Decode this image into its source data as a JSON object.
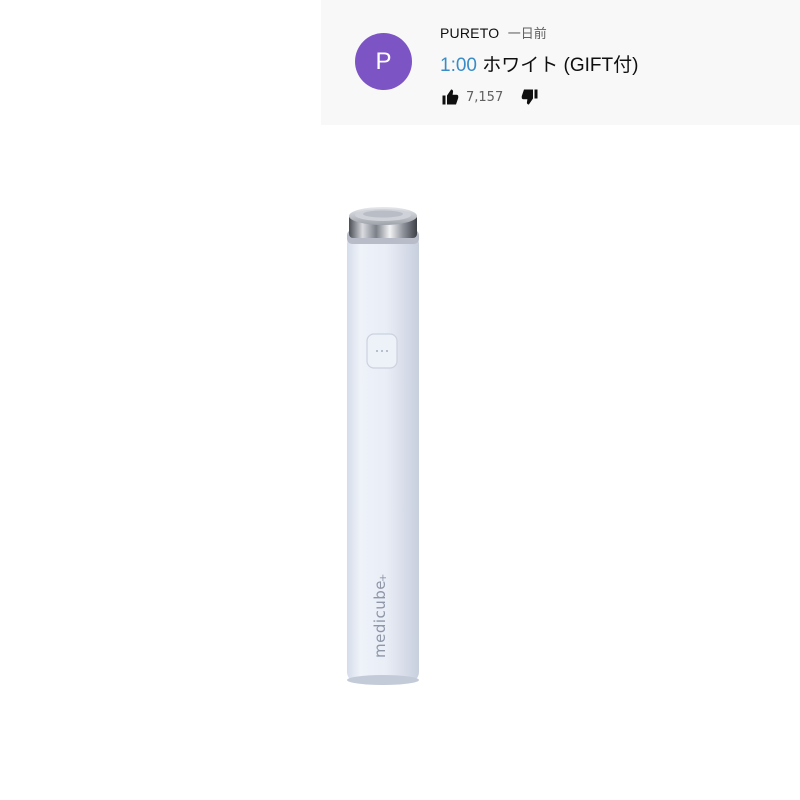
{
  "comment": {
    "avatar_letter": "P",
    "avatar_color": "#7d54c4",
    "author": "PURETO",
    "time_ago": "一日前",
    "timestamp": "1:00",
    "text": " ホワイト (GIFT付)",
    "like_count": "7,157",
    "like_icon": "thumbs-up-icon",
    "dislike_icon": "thumbs-down-icon"
  },
  "product": {
    "brand_text": "medicube",
    "body_color": "#e8edf6"
  }
}
